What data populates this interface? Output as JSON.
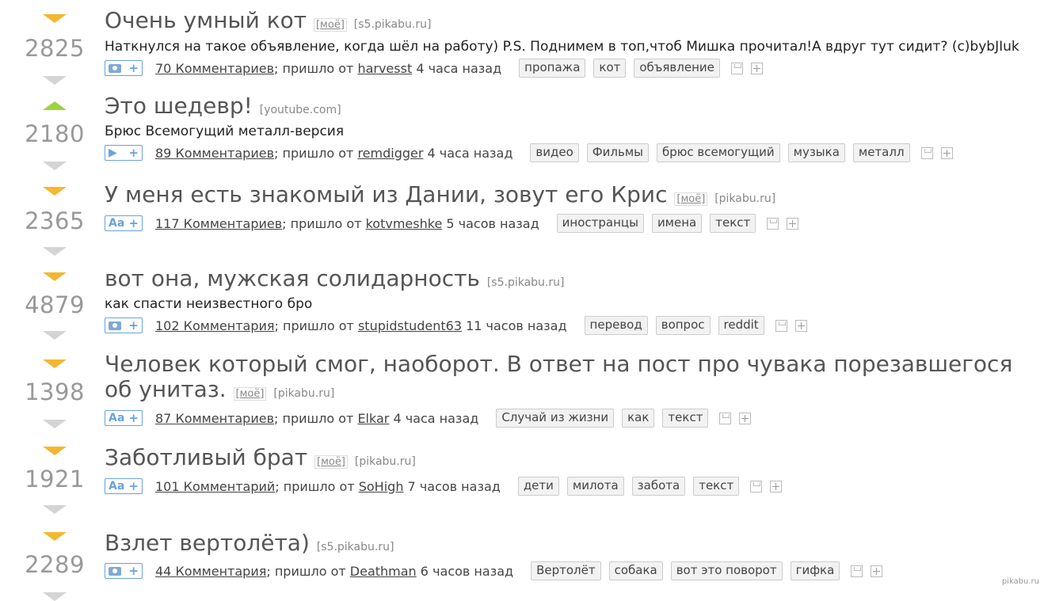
{
  "labels": {
    "moe": "[моё]",
    "from": "; пришло от"
  },
  "posts": [
    {
      "score": "2825",
      "vote_state": "none",
      "title": "Очень умный кот",
      "moe": true,
      "source": "[s5.pikabu.ru]",
      "description": "Наткнулся на такое объявление, когда шёл на работу) P.S. Поднимем в топ,чтоб Мишка прочитал!А вдруг тут сидит? (c)bybJIuk",
      "type_icon": "camera-icon",
      "comments": "70 Комментариев",
      "user": "harvesst",
      "time": "4 часа назад",
      "tags": [
        "пропажа",
        "кот",
        "объявление"
      ]
    },
    {
      "score": "2180",
      "vote_state": "up",
      "title": "Это шедевр!",
      "moe": false,
      "source": "[youtube.com]",
      "description": "Брюс Всемогущий металл-версия",
      "type_icon": "play-icon",
      "comments": "89 Комментариев",
      "user": "remdigger",
      "time": "4 часа назад",
      "tags": [
        "видео",
        "Фильмы",
        "брюс всемогущий",
        "музыка",
        "металл"
      ]
    },
    {
      "score": "2365",
      "vote_state": "none",
      "title": "У меня есть знакомый из Дании, зовут его Крис",
      "moe": true,
      "source": "[pikabu.ru]",
      "description": "",
      "type_icon": "text-icon",
      "comments": "117 Комментариев",
      "user": "kotvmeshke",
      "time": "5 часов назад",
      "tags": [
        "иностранцы",
        "имена",
        "текст"
      ]
    },
    {
      "score": "4879",
      "vote_state": "none",
      "title": "вот она, мужская солидарность",
      "moe": false,
      "source": "[s5.pikabu.ru]",
      "description": "как спасти неизвестного бро",
      "type_icon": "camera-icon",
      "comments": "102 Комментария",
      "user": "stupidstudent63",
      "time": "11 часов назад",
      "tags": [
        "перевод",
        "вопрос",
        "reddit"
      ]
    },
    {
      "score": "1398",
      "vote_state": "none",
      "title": "Человек который смог, наоборот. В ответ на пост про чувака порезавшегося об унитаз.",
      "moe": true,
      "source": "[pikabu.ru]",
      "description": "",
      "type_icon": "text-icon",
      "comments": "87 Комментариев",
      "user": "Elkar",
      "time": "4 часа назад",
      "tags": [
        "Случай из жизни",
        "как",
        "текст"
      ]
    },
    {
      "score": "1921",
      "vote_state": "none",
      "title": "Заботливый брат",
      "moe": true,
      "source": "[pikabu.ru]",
      "description": "",
      "type_icon": "text-icon",
      "comments": "101 Комментарий",
      "user": "SoHigh",
      "time": "7 часов назад",
      "tags": [
        "дети",
        "милота",
        "забота",
        "текст"
      ]
    },
    {
      "score": "2289",
      "vote_state": "none",
      "title": "Взлет вертолёта)",
      "moe": false,
      "source": "[s5.pikabu.ru]",
      "description": "",
      "type_icon": "camera-icon",
      "comments": "44 Комментария",
      "user": "Deathman",
      "time": "6 часов назад",
      "tags": [
        "Вертолёт",
        "собака",
        "вот это поворот",
        "гифка"
      ]
    }
  ],
  "type_labels": {
    "text-icon": "Aa",
    "plus": "+"
  },
  "watermark": "pikabu.ru",
  "colors": {
    "vote_orange": "#f4b731",
    "vote_green": "#9bd33c",
    "vote_grey": "#d4d4d4",
    "link_blue": "#6aa2d8"
  }
}
